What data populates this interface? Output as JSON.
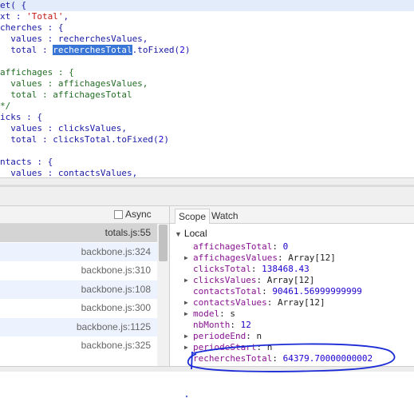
{
  "editor": {
    "lines": [
      {
        "parts": [
          {
            "t": "et( {",
            "c": "tok-default"
          }
        ],
        "first": true
      },
      {
        "parts": [
          {
            "t": "xt : ",
            "c": "tok-default"
          },
          {
            "t": "'Total'",
            "c": "tok-str"
          },
          {
            "t": ",",
            "c": "tok-default"
          }
        ]
      },
      {
        "parts": [
          {
            "t": "cherches : {",
            "c": "tok-default"
          }
        ]
      },
      {
        "parts": [
          {
            "t": "  values : recherchesValues,",
            "c": "tok-default"
          }
        ]
      },
      {
        "parts": [
          {
            "t": "  total : ",
            "c": "tok-default"
          },
          {
            "t": "recherchesTotal",
            "c": "tok-sel"
          },
          {
            "t": ".toFixed(",
            "c": "tok-default"
          },
          {
            "t": "2",
            "c": "tok-num"
          },
          {
            "t": ")",
            "c": "tok-default"
          }
        ]
      },
      {
        "parts": [
          {
            "t": "",
            "c": "tok-default"
          }
        ]
      },
      {
        "parts": [
          {
            "t": "affichages : {",
            "c": "tok-cmt"
          }
        ]
      },
      {
        "parts": [
          {
            "t": "  values : affichagesValues,",
            "c": "tok-cmt"
          }
        ]
      },
      {
        "parts": [
          {
            "t": "  total : affichagesTotal",
            "c": "tok-cmt"
          }
        ]
      },
      {
        "parts": [
          {
            "t": "*/",
            "c": "tok-cmt"
          }
        ]
      },
      {
        "parts": [
          {
            "t": "icks : {",
            "c": "tok-default"
          }
        ]
      },
      {
        "parts": [
          {
            "t": "  values : clicksValues,",
            "c": "tok-default"
          }
        ]
      },
      {
        "parts": [
          {
            "t": "  total : clicksTotal.toFixed(",
            "c": "tok-default"
          },
          {
            "t": "2",
            "c": "tok-num"
          },
          {
            "t": ")",
            "c": "tok-default"
          }
        ]
      },
      {
        "parts": [
          {
            "t": "",
            "c": "tok-default"
          }
        ]
      },
      {
        "parts": [
          {
            "t": "ntacts : {",
            "c": "tok-default"
          }
        ]
      },
      {
        "parts": [
          {
            "t": "  values : contactsValues,",
            "c": "tok-default"
          }
        ]
      }
    ]
  },
  "callstack": {
    "async_label": "Async",
    "frames": [
      "totals.js:55",
      "backbone.js:324",
      "backbone.js:310",
      "backbone.js:108",
      "backbone.js:300",
      "backbone.js:1125",
      "backbone.js:325"
    ]
  },
  "scope": {
    "tabs": [
      "Scope",
      "Watch"
    ],
    "section": "Local",
    "vars": [
      {
        "name": "affichagesTotal",
        "value": "0",
        "type": "num",
        "expandable": false
      },
      {
        "name": "affichagesValues",
        "value": "Array[12]",
        "type": "str",
        "expandable": true
      },
      {
        "name": "clicksTotal",
        "value": "138468.43",
        "type": "num",
        "expandable": false
      },
      {
        "name": "clicksValues",
        "value": "Array[12]",
        "type": "str",
        "expandable": true
      },
      {
        "name": "contactsTotal",
        "value": "90461.56999999999",
        "type": "num",
        "expandable": false
      },
      {
        "name": "contactsValues",
        "value": "Array[12]",
        "type": "str",
        "expandable": true
      },
      {
        "name": "model",
        "value": "s",
        "type": "str",
        "expandable": true
      },
      {
        "name": "nbMonth",
        "value": "12",
        "type": "num",
        "expandable": false
      },
      {
        "name": "periodeEnd",
        "value": "n",
        "type": "str",
        "expandable": true
      },
      {
        "name": "periodeStart",
        "value": "n",
        "type": "str",
        "expandable": true
      },
      {
        "name": "recherchesTotal",
        "value": "64379.70000000002",
        "type": "num",
        "expandable": false
      }
    ]
  },
  "colors": {
    "selection": "#3875d7",
    "annotation": "#1a2bd6",
    "var_name": "#881391",
    "number": "#1c00cf"
  }
}
